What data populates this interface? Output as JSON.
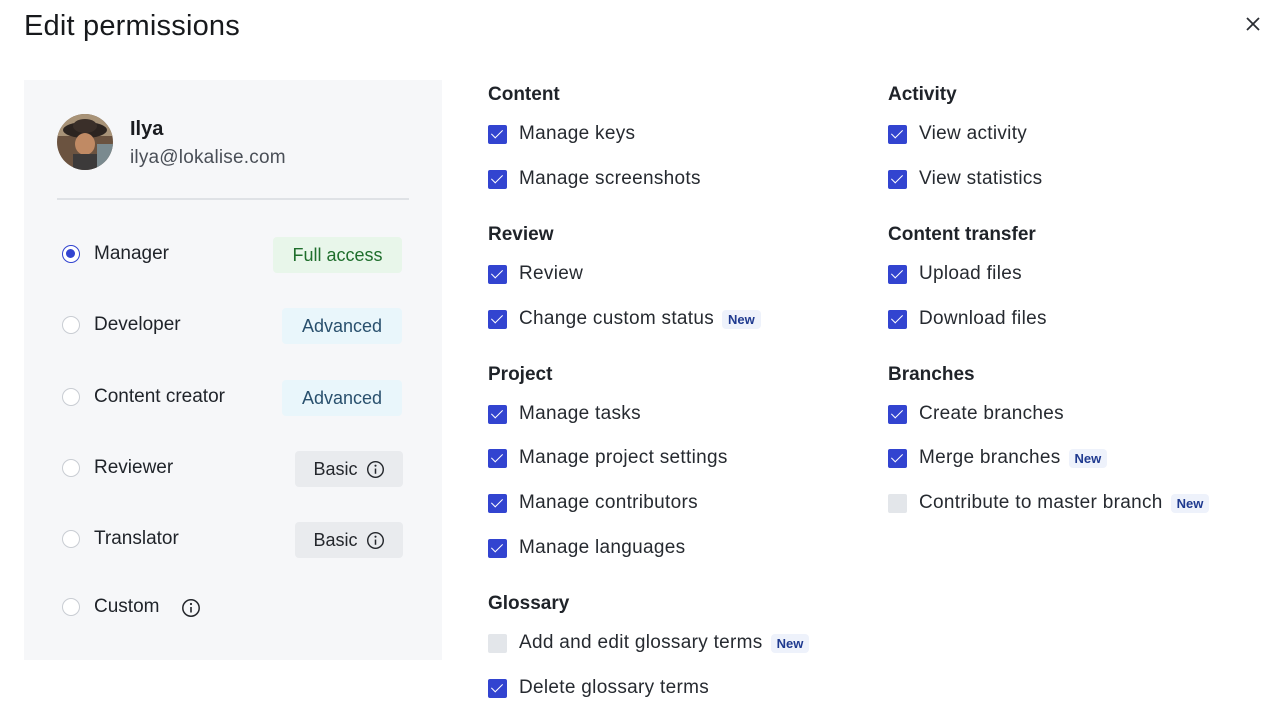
{
  "dialog": {
    "title": "Edit permissions",
    "close_icon": "close-icon"
  },
  "user": {
    "name": "Ilya",
    "email": "ilya@lokalise.com"
  },
  "roles": [
    {
      "label": "Manager",
      "badge": "Full access",
      "selected": true
    },
    {
      "label": "Developer",
      "badge": "Advanced",
      "selected": false
    },
    {
      "label": "Content creator",
      "badge": "Advanced",
      "selected": false
    },
    {
      "label": "Reviewer",
      "badge": "Basic",
      "selected": false
    },
    {
      "label": "Translator",
      "badge": "Basic",
      "selected": false
    },
    {
      "label": "Custom",
      "badge": "",
      "selected": false
    }
  ],
  "new_label": "New",
  "sections": {
    "content": {
      "title": "Content",
      "items": [
        {
          "label": "Manage keys",
          "checked": true
        },
        {
          "label": "Manage screenshots",
          "checked": true
        }
      ]
    },
    "review": {
      "title": "Review",
      "items": [
        {
          "label": "Review",
          "checked": true
        },
        {
          "label": "Change custom status",
          "checked": true,
          "new": true
        }
      ]
    },
    "project": {
      "title": "Project",
      "items": [
        {
          "label": "Manage tasks",
          "checked": true
        },
        {
          "label": "Manage project settings",
          "checked": true
        },
        {
          "label": "Manage contributors",
          "checked": true
        },
        {
          "label": "Manage languages",
          "checked": true
        }
      ]
    },
    "glossary": {
      "title": "Glossary",
      "items": [
        {
          "label": "Add and edit glossary terms",
          "checked": false,
          "new": true
        },
        {
          "label": "Delete glossary terms",
          "checked": true
        }
      ]
    },
    "activity": {
      "title": "Activity",
      "items": [
        {
          "label": "View activity",
          "checked": true
        },
        {
          "label": "View statistics",
          "checked": true
        }
      ]
    },
    "content_transfer": {
      "title": "Content transfer",
      "items": [
        {
          "label": "Upload files",
          "checked": true
        },
        {
          "label": "Download files",
          "checked": true
        }
      ]
    },
    "branches": {
      "title": "Branches",
      "items": [
        {
          "label": "Create branches",
          "checked": true
        },
        {
          "label": "Merge branches",
          "checked": true,
          "new": true
        },
        {
          "label": "Contribute to master branch",
          "checked": false,
          "new": true
        }
      ]
    }
  },
  "colors": {
    "accent": "#3244d0",
    "panel_bg": "#f6f7f9"
  }
}
